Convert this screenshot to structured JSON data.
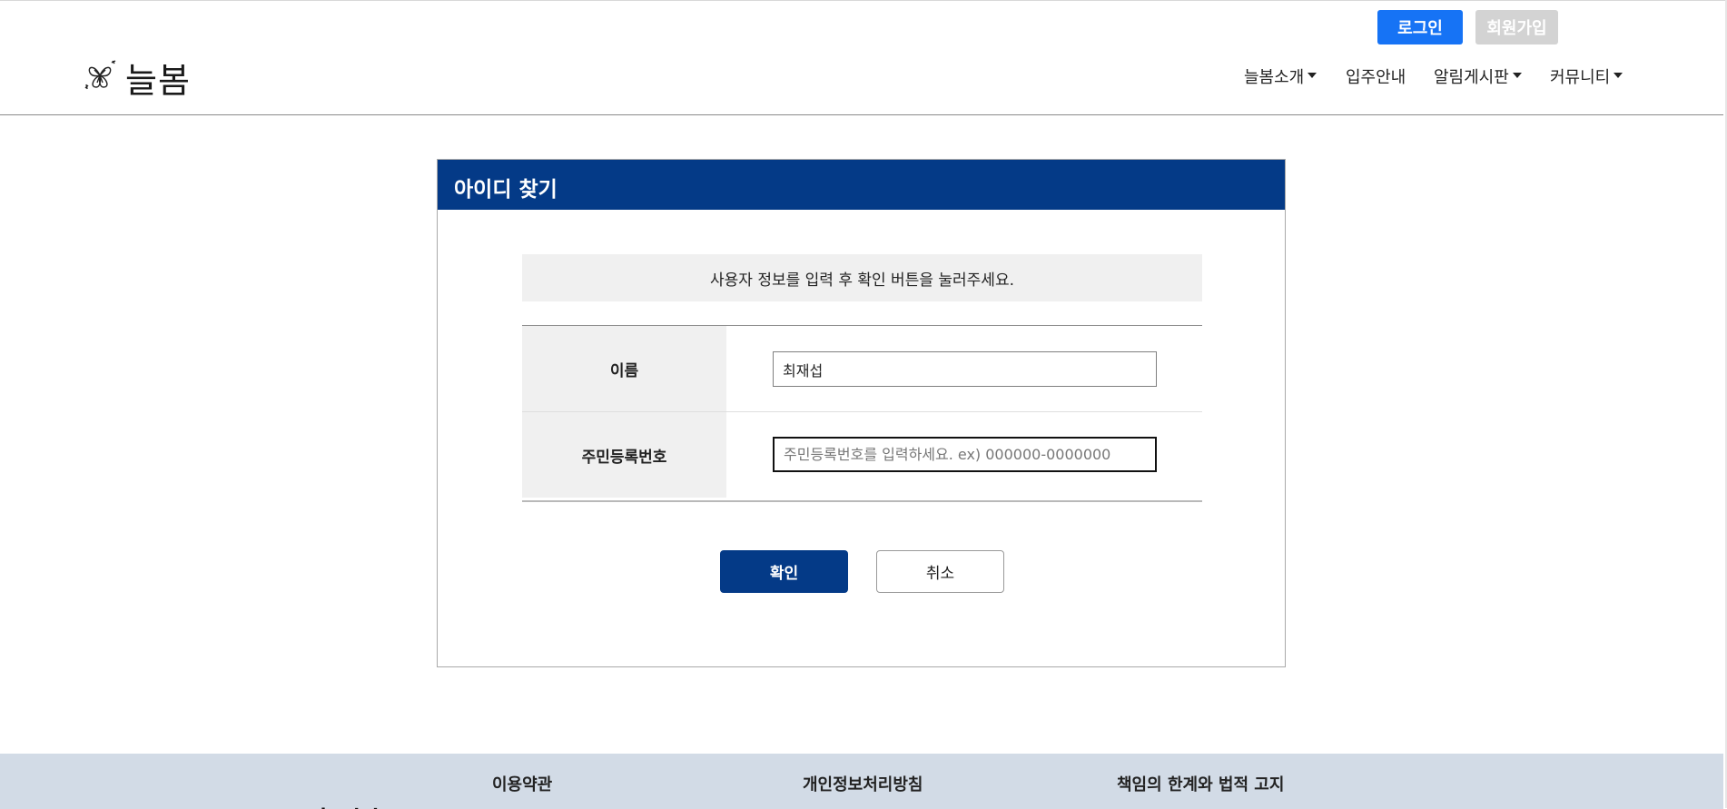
{
  "header": {
    "login_label": "로그인",
    "signup_label": "회원가입",
    "logo_text": "늘봄",
    "nav": [
      {
        "label": "늘봄소개",
        "dropdown": true
      },
      {
        "label": "입주안내",
        "dropdown": false
      },
      {
        "label": "알림게시판",
        "dropdown": true
      },
      {
        "label": "커뮤니티",
        "dropdown": true
      }
    ]
  },
  "panel": {
    "title": "아이디 찾기",
    "notice": "사용자 정보를 입력 후 확인 버튼을 눌러주세요.",
    "fields": {
      "name_label": "이름",
      "name_value": "최재섭",
      "rrn_label": "주민등록번호",
      "rrn_value": "",
      "rrn_placeholder": "주민등록번호를 입력하세요. ex) 000000-0000000"
    },
    "confirm_label": "확인",
    "cancel_label": "취소"
  },
  "footer": {
    "links": [
      "이용약관",
      "개인정보처리방침",
      "책임의 한계와 법적 고지"
    ],
    "logo_text": "늘봄"
  },
  "colors": {
    "primary_navy": "#043a87",
    "login_blue": "#1673f5",
    "signup_gray": "#d3d3d3",
    "footer_bg": "#d2dbe6"
  },
  "icons": {
    "logo": "clover-flower-icon",
    "caret": "caret-down-icon"
  }
}
